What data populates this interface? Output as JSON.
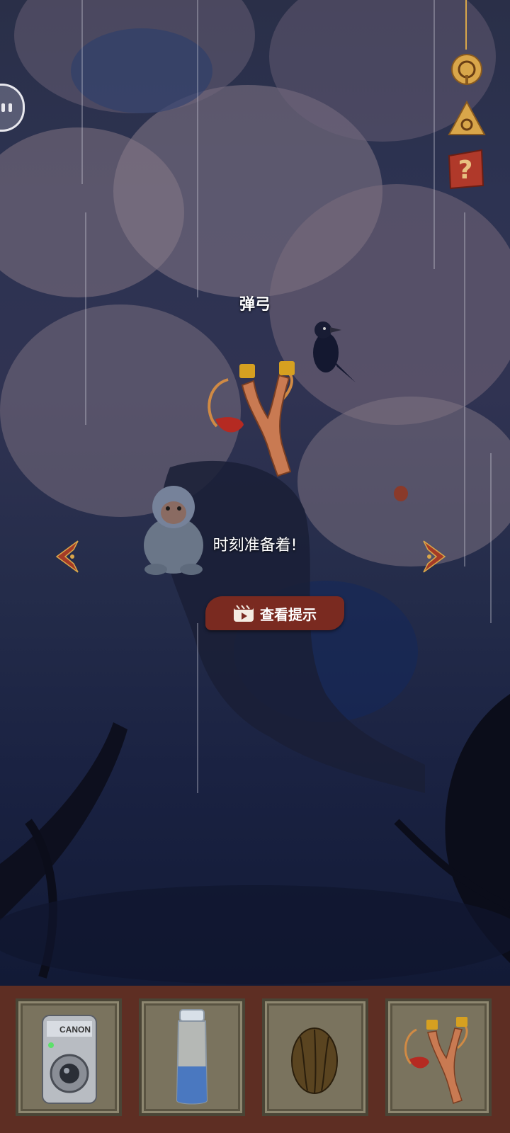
{
  "scene": {
    "item_title": "弹弓",
    "item_description": "时刻准备着!"
  },
  "buttons": {
    "hint_label": "查看提示",
    "hint_icon": "video-clapper-icon",
    "nav_left_icon": "chevron-left-icon",
    "nav_right_icon": "chevron-right-icon",
    "pause_icon": "pause-icon",
    "settings_icon": "ring-icon",
    "map_icon": "triangle-cluster-icon",
    "help_icon": "question-icon"
  },
  "inventory": {
    "slots": [
      {
        "item": "camera",
        "brand_text": "CANON"
      },
      {
        "item": "water-bottle"
      },
      {
        "item": "seed-nut"
      },
      {
        "item": "slingshot"
      }
    ]
  },
  "colors": {
    "accent_red": "#7a2a20",
    "gold": "#d9a64a",
    "inventory_bg": "#5e2e23"
  }
}
